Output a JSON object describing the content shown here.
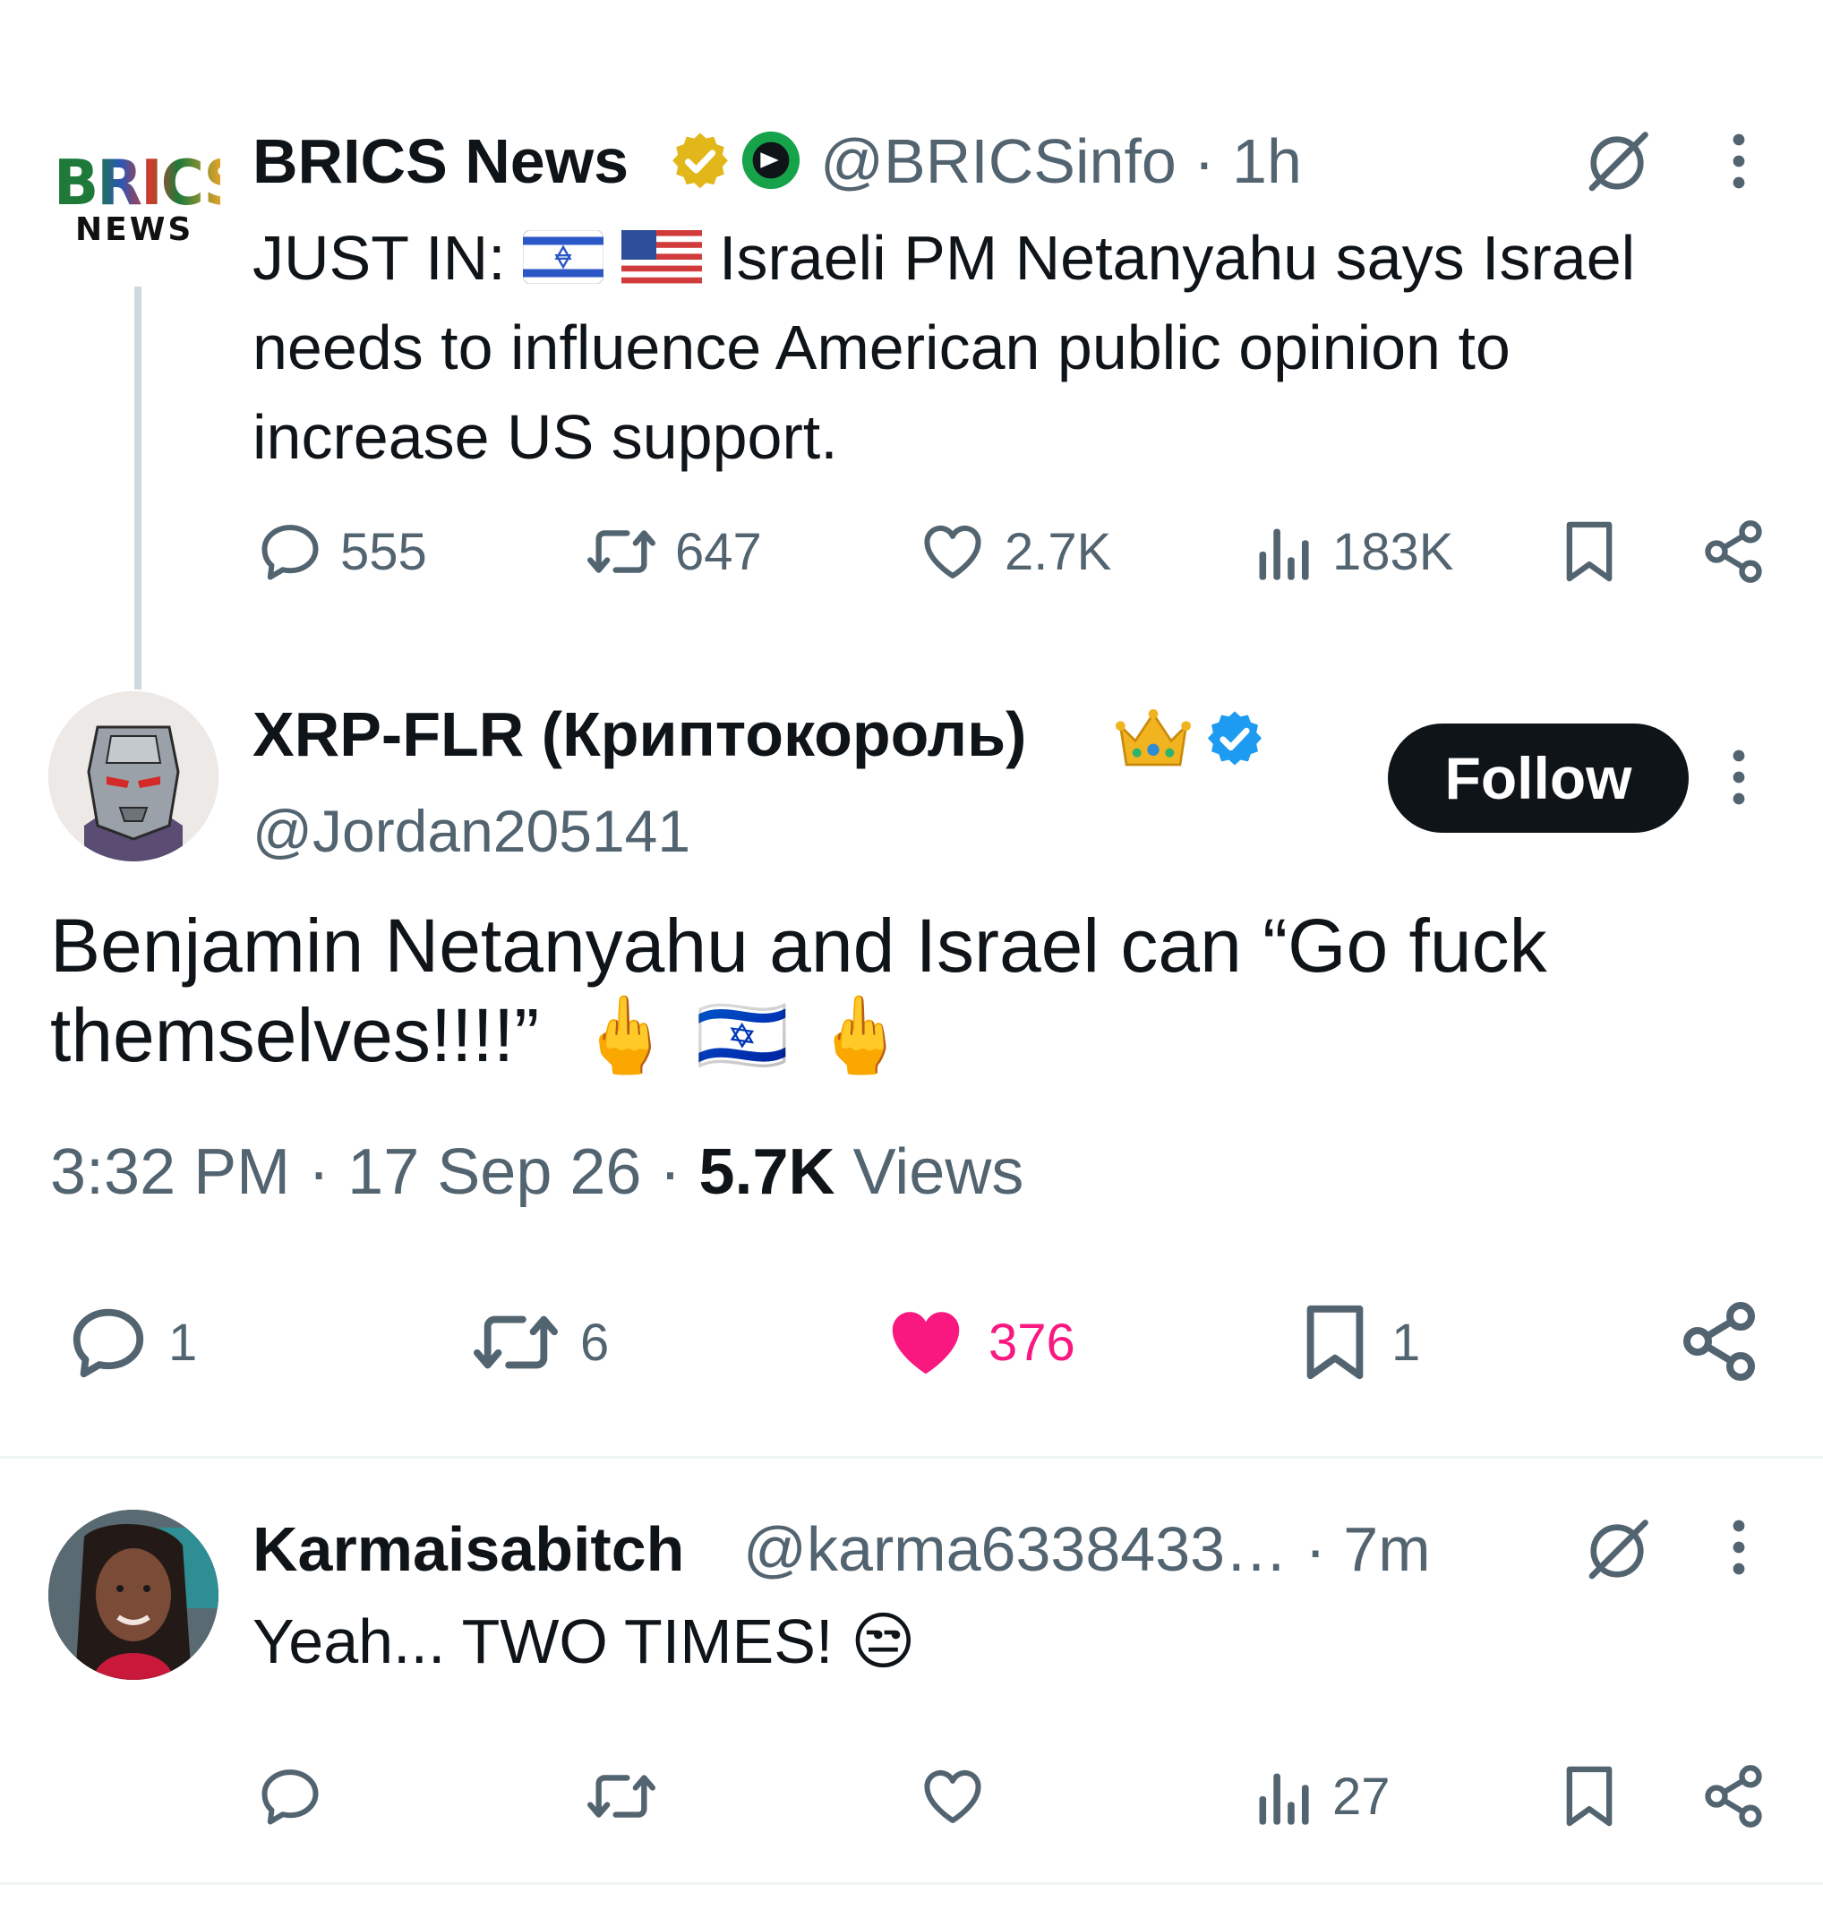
{
  "tweet1": {
    "logo_text": "BRICS",
    "logo_subtext": "NEWS",
    "name": "BRICS News",
    "handle_time": "@BRICSinfo · 1h",
    "text_prefix": "JUST IN:",
    "text_body": "Israeli PM Netanyahu says Israel needs to influence American public opinion to increase US support.",
    "stats": {
      "replies": "555",
      "reposts": "647",
      "likes": "2.7K",
      "views": "183K"
    }
  },
  "tweet2": {
    "name": "XRP-FLR (Криптокороль)",
    "handle": "@Jordan205141",
    "follow_label": "Follow",
    "text_line1": "Benjamin Netanyahu and Israel can “Go fuck",
    "text_line2": "themselves!!!!”",
    "emoji_tail": "🖕 🇮🇱 🖕",
    "time": "3:32 PM",
    "date": "17 Sep 26",
    "views_count": "5.7K",
    "views_label": "Views",
    "stats": {
      "replies": "1",
      "reposts": "6",
      "likes": "376",
      "bookmarks": "1"
    },
    "like_color": "#f91880"
  },
  "tweet3": {
    "name": "Karmaisabitch",
    "handle_time": "@karma6338433…  · 7m",
    "text": "Yeah... TWO TIMES!",
    "emoji": "😒",
    "stats": {
      "views": "27"
    }
  },
  "icons": [
    "grok-icon",
    "more-icon",
    "reply-icon",
    "repost-icon",
    "like-icon",
    "views-icon",
    "bookmark-icon",
    "share-icon",
    "verified-gold-icon",
    "verified-blue-icon",
    "crown-icon"
  ],
  "colors": {
    "text": "#0f1419",
    "secondary": "#536471",
    "verified_blue": "#1d9bf0",
    "verified_gold": "#e2b719",
    "like": "#f91880"
  }
}
